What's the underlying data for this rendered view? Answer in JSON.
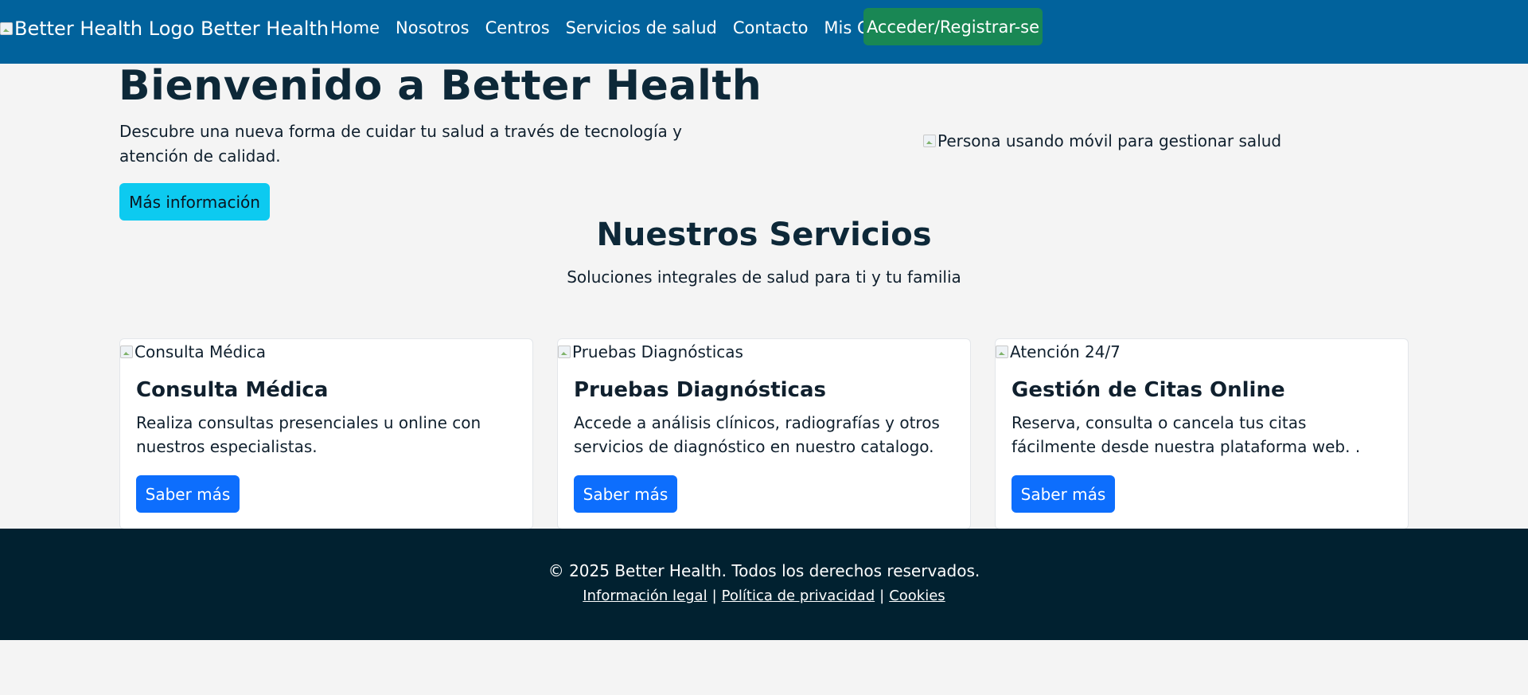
{
  "navbar": {
    "brand_alt": "Better Health Logo",
    "brand_name": "Better Health",
    "links": [
      "Home",
      "Nosotros",
      "Centros",
      "Servicios de salud",
      "Contacto",
      "Mis Citas"
    ],
    "cta": "Acceder/Registrar-se",
    "colors": {
      "background": "#01629c",
      "cta": "#198754"
    }
  },
  "hero": {
    "title": "Bienvenido a Better Health",
    "text": "Descubre una nueva forma de cuidar tu salud a través de tecnología y atención de calidad.",
    "button": "Más información",
    "image_alt": "Persona usando móvil para gestionar salud"
  },
  "services": {
    "title": "Nuestros Servicios",
    "subtitle": "Soluciones integrales de salud para ti y tu familia",
    "cards": [
      {
        "image_alt": "Consulta Médica",
        "title": "Consulta Médica",
        "text": "Realiza consultas presenciales u online con nuestros especialistas.",
        "button": "Saber más"
      },
      {
        "image_alt": "Pruebas Diagnósticas",
        "title": "Pruebas Diagnósticas",
        "text": "Accede a análisis clínicos, radiografías y otros servicios de diagnóstico en nuestro catalogo.",
        "button": "Saber más"
      },
      {
        "image_alt": "Atención 24/7",
        "title": "Gestión de Citas Online",
        "text": "Reserva, consulta o cancela tus citas fácilmente desde nuestra plataforma web. .",
        "button": "Saber más"
      }
    ]
  },
  "footer": {
    "copyright": "© 2025 Better Health. Todos los derechos reservados.",
    "links": [
      "Información legal",
      "Política de privacidad",
      "Cookies"
    ],
    "separator": "|"
  }
}
